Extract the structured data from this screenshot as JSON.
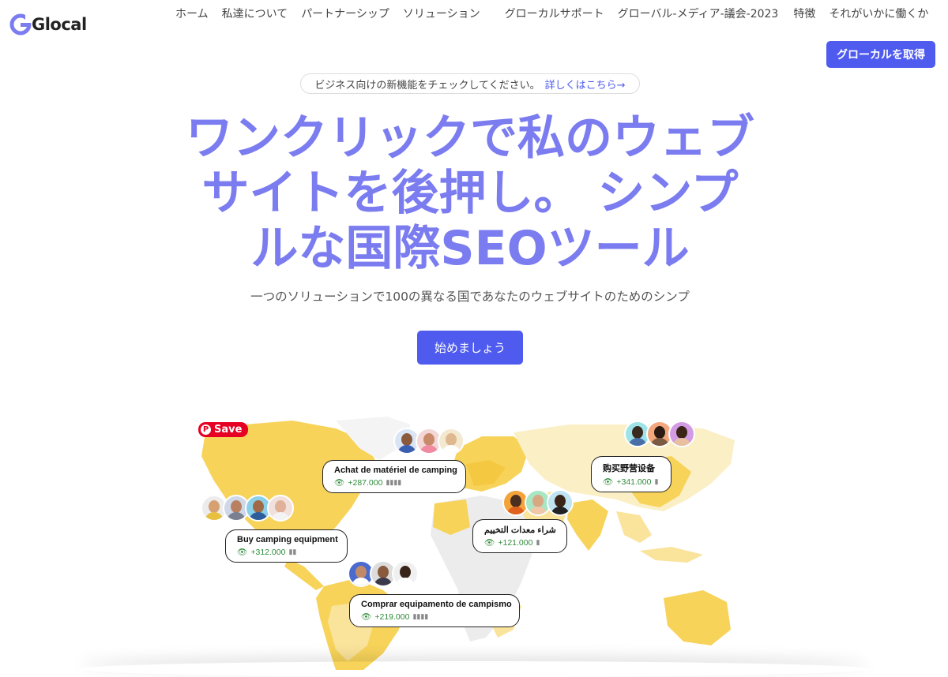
{
  "brand": {
    "name": "Glocal",
    "logo_letter": "G",
    "accent": "#4f5bef",
    "hero_color": "#7b7cf0"
  },
  "nav": {
    "items": [
      "ホーム",
      "私達について",
      "パートナーシップ",
      "ソリューション",
      "グローカルサポート",
      "グローバル-メディア-議会-2023",
      "特徴",
      "それがいかに働くか"
    ],
    "cta": "グローカルを取得"
  },
  "announcement": {
    "text": "ビジネス向けの新機能をチェックしてください。",
    "link": "詳しくはこちら→"
  },
  "hero": {
    "lines": [
      "ワンクリックで私のウェブ",
      "サイトを後押し。 シンプ",
      "ルな国際SEOツール"
    ]
  },
  "subtitle": "一つのソリューションで100の異なる国であなたのウェブサイトのためのシンプ",
  "start_button": "始めましょう",
  "save_badge": "Save",
  "cards": [
    {
      "title": "Achat de matériel de camping",
      "value": "+287.000"
    },
    {
      "title": "购买野营设备",
      "value": "+341.000"
    },
    {
      "title": "Buy camping equipment",
      "value": "+312.000"
    },
    {
      "title": "شراء معدات التخييم",
      "value": "+121.000"
    },
    {
      "title": "Comprar equipamento de campismo",
      "value": "+219.000"
    }
  ]
}
